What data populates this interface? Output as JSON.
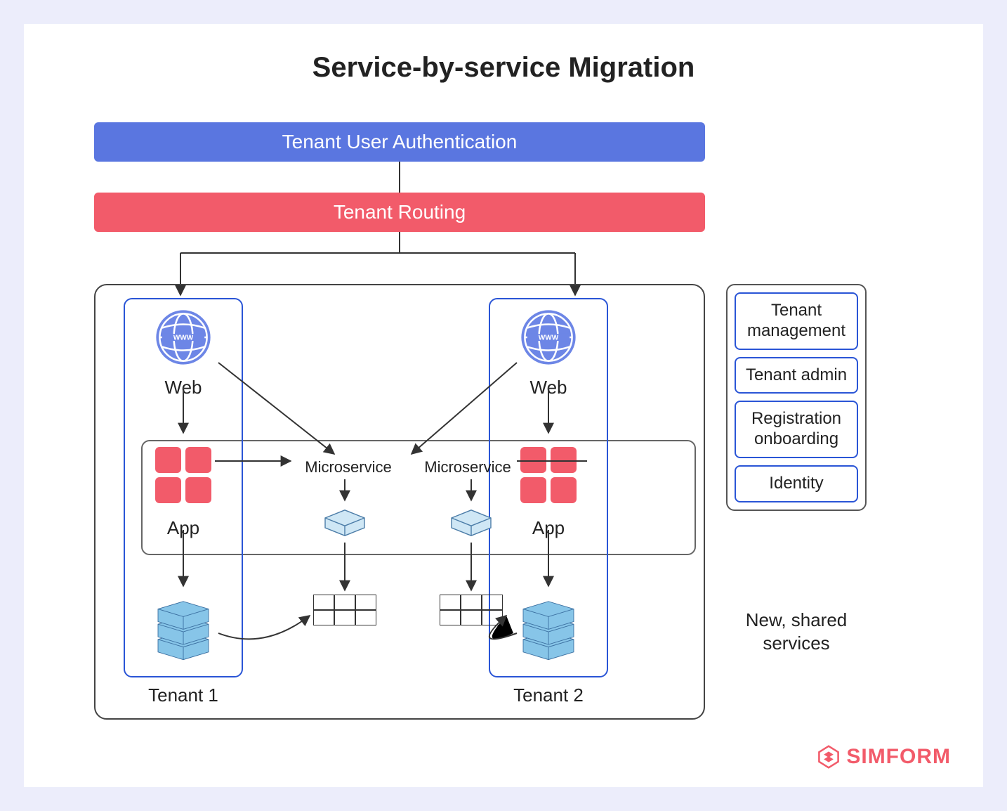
{
  "title": "Service-by-service Migration",
  "auth_bar": "Tenant User Authentication",
  "route_bar": "Tenant Routing",
  "web_label": "Web",
  "app_label": "App",
  "microservice_label": "Microservice",
  "tenant1_caption": "Tenant 1",
  "tenant2_caption": "Tenant 2",
  "shared_services": {
    "items": [
      "Tenant management",
      "Tenant admin",
      "Registration onboarding",
      "Identity"
    ],
    "caption": "New, shared services"
  },
  "logo_text": "SIMFORM"
}
